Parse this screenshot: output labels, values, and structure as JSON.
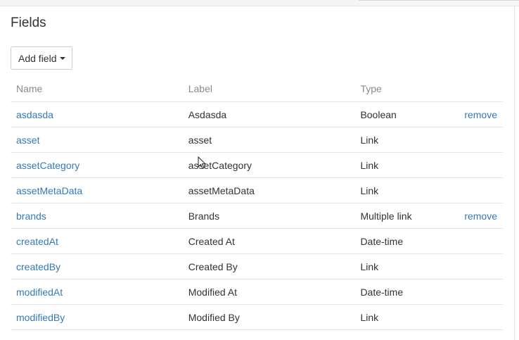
{
  "header": {
    "title": "Fields"
  },
  "toolbar": {
    "add_field_label": "Add field"
  },
  "table": {
    "columns": [
      "Name",
      "Label",
      "Type"
    ],
    "rows": [
      {
        "name": "asdasda",
        "label": "Asdasda",
        "type": "Boolean",
        "action": "remove"
      },
      {
        "name": "asset",
        "label": "asset",
        "type": "Link",
        "action": ""
      },
      {
        "name": "assetCategory",
        "label": "assetCategory",
        "type": "Link",
        "action": ""
      },
      {
        "name": "assetMetaData",
        "label": "assetMetaData",
        "type": "Link",
        "action": ""
      },
      {
        "name": "brands",
        "label": "Brands",
        "type": "Multiple link",
        "action": "remove"
      },
      {
        "name": "createdAt",
        "label": "Created At",
        "type": "Date-time",
        "action": ""
      },
      {
        "name": "createdBy",
        "label": "Created By",
        "type": "Link",
        "action": ""
      },
      {
        "name": "modifiedAt",
        "label": "Modified At",
        "type": "Date-time",
        "action": ""
      },
      {
        "name": "modifiedBy",
        "label": "Modified By",
        "type": "Link",
        "action": ""
      }
    ]
  },
  "colors": {
    "link": "#337ab7",
    "header_text": "#8a8a8a",
    "border": "#e5e5e5"
  },
  "icons": {
    "dropdown": "caret-down-icon",
    "pointer": "mouse-cursor-icon"
  }
}
